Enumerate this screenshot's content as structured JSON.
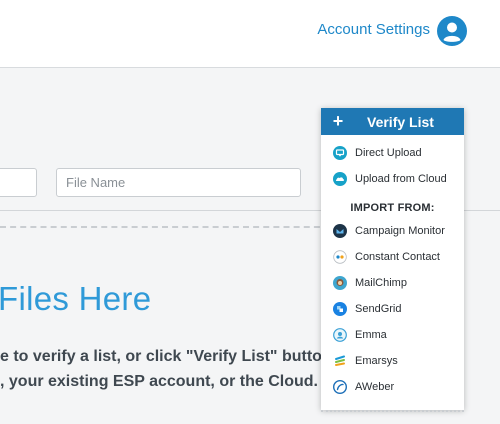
{
  "header": {
    "account_settings_label": "Account Settings"
  },
  "upload_form": {
    "file_name_placeholder": "File Name"
  },
  "dropzone": {
    "title": "Files Here",
    "line1": "e to verify a list, or click \"Verify List\" button",
    "line2": ", your existing ESP account, or the Cloud."
  },
  "verify_menu": {
    "button_label": "Verify List",
    "plus_symbol": "+",
    "upload_options": [
      {
        "label": "Direct Upload",
        "icon": "monitor-icon"
      },
      {
        "label": "Upload from Cloud",
        "icon": "cloud-upload-icon"
      }
    ],
    "import_heading": "IMPORT FROM:",
    "import_options": [
      {
        "label": "Campaign Monitor",
        "icon": "campaign-monitor-logo"
      },
      {
        "label": "Constant Contact",
        "icon": "constant-contact-logo"
      },
      {
        "label": "MailChimp",
        "icon": "mailchimp-logo"
      },
      {
        "label": "SendGrid",
        "icon": "sendgrid-logo"
      },
      {
        "label": "Emma",
        "icon": "emma-logo"
      },
      {
        "label": "Emarsys",
        "icon": "emarsys-logo"
      },
      {
        "label": "AWeber",
        "icon": "aweber-logo"
      }
    ]
  },
  "colors": {
    "brand_blue": "#1f78b4",
    "link_blue": "#1e88c9",
    "title_blue": "#2f9ad8"
  }
}
